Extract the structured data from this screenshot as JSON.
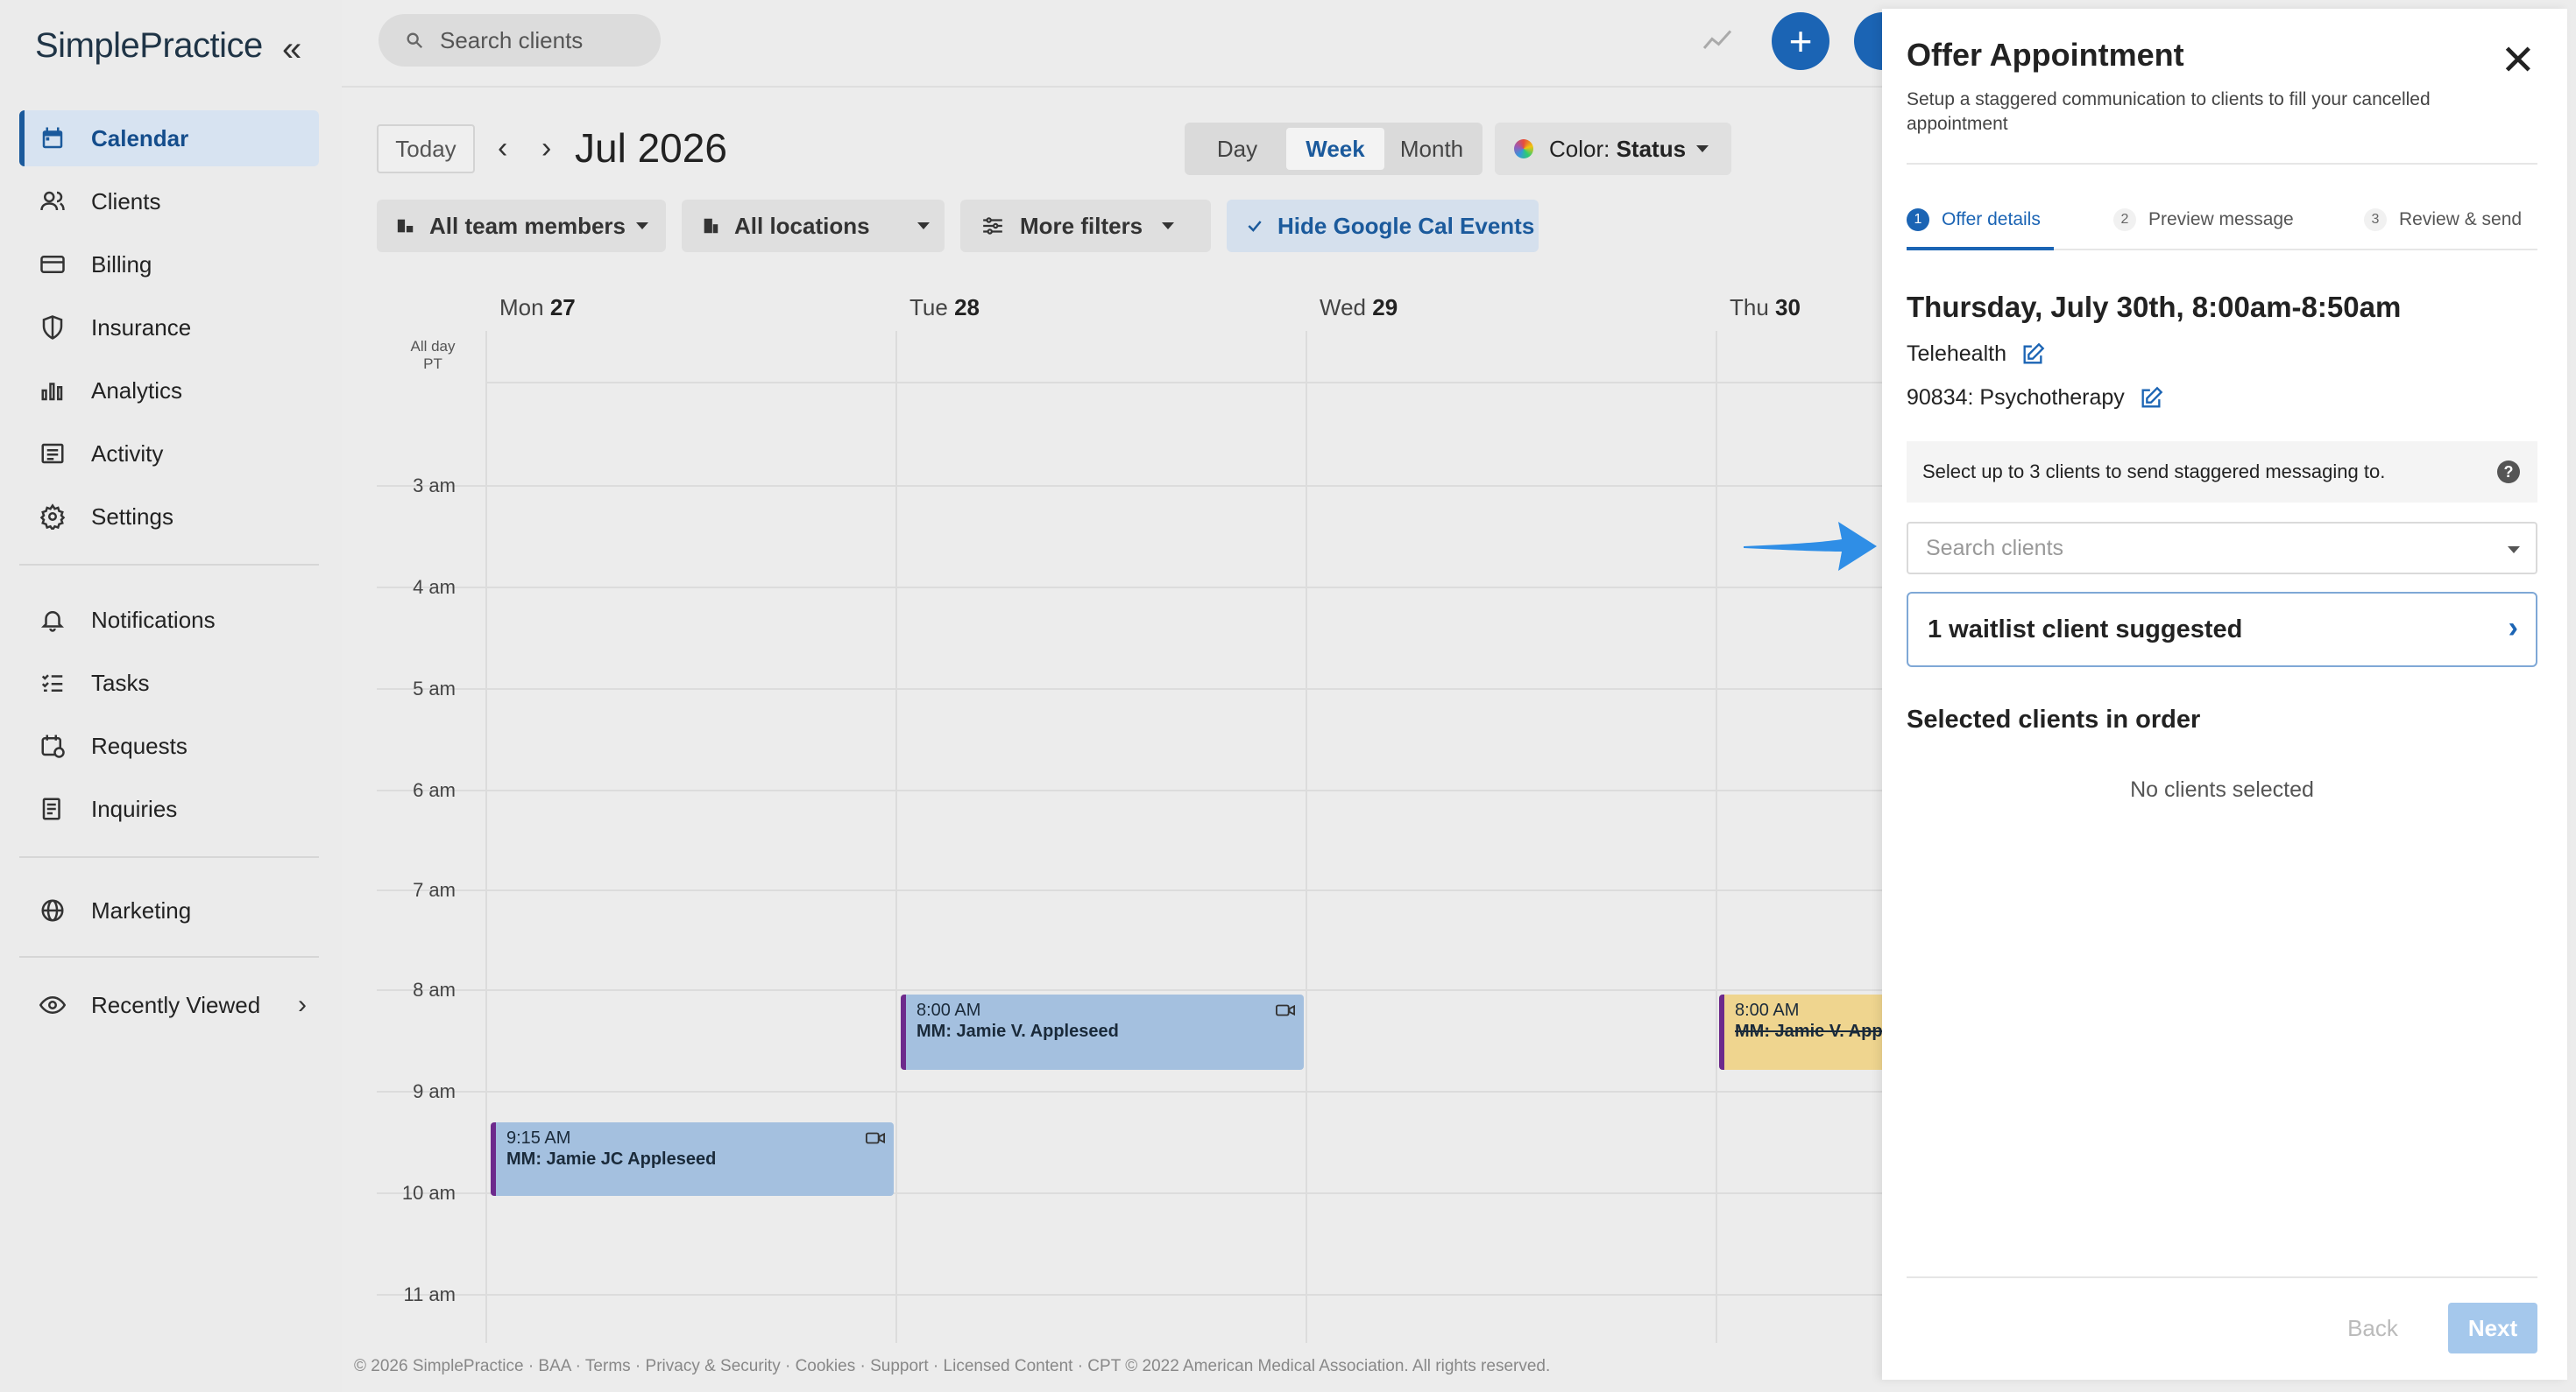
{
  "sidebar": {
    "logo": "SimplePractice",
    "items": [
      {
        "label": "Calendar"
      },
      {
        "label": "Clients"
      },
      {
        "label": "Billing"
      },
      {
        "label": "Insurance"
      },
      {
        "label": "Analytics"
      },
      {
        "label": "Activity"
      },
      {
        "label": "Settings"
      },
      {
        "label": "Notifications"
      },
      {
        "label": "Tasks"
      },
      {
        "label": "Requests"
      },
      {
        "label": "Inquiries"
      },
      {
        "label": "Marketing"
      },
      {
        "label": "Recently Viewed"
      }
    ]
  },
  "topbar": {
    "search_placeholder": "Search clients"
  },
  "toolbar": {
    "today": "Today",
    "month": "Jul 2026",
    "views": [
      "Day",
      "Week",
      "Month"
    ],
    "selected_view": "Week",
    "color_prefix": "Color: ",
    "color_value": "Status",
    "filters": {
      "team": "All team members",
      "locations": "All locations",
      "more": "More filters",
      "hide_google": "Hide Google Cal Events"
    }
  },
  "calendar": {
    "days": [
      {
        "dow": "Mon",
        "num": "27"
      },
      {
        "dow": "Tue",
        "num": "28"
      },
      {
        "dow": "Wed",
        "num": "29"
      },
      {
        "dow": "Thu",
        "num": "30"
      }
    ],
    "allday_label": "All day",
    "tz_label": "PT",
    "hours": [
      "3 am",
      "4 am",
      "5 am",
      "6 am",
      "7 am",
      "8 am",
      "9 am",
      "10 am",
      "11 am"
    ],
    "events": [
      {
        "time": "8:00 AM",
        "name": "MM: Jamie V. Appleseed"
      },
      {
        "time": "9:15 AM",
        "name": "MM: Jamie JC Appleseed"
      },
      {
        "time": "8:00 AM",
        "name": "MM: Jamie V. App"
      }
    ]
  },
  "footer": "© 2026 SimplePractice · BAA · Terms · Privacy & Security · Cookies · Support · Licensed Content · CPT © 2022 American Medical Association. All rights reserved.",
  "panel": {
    "title": "Offer Appointment",
    "subtitle": "Setup a staggered communication to clients to fill your cancelled appointment",
    "steps": [
      {
        "num": "1",
        "label": "Offer details"
      },
      {
        "num": "2",
        "label": "Preview message"
      },
      {
        "num": "3",
        "label": "Review & send"
      }
    ],
    "datetime": "Thursday, July 30th, 8:00am-8:50am",
    "location": "Telehealth",
    "service": "90834: Psychotherapy",
    "info": "Select up to 3 clients to send staggered messaging to.",
    "search_placeholder": "Search clients",
    "waitlist": "1 waitlist client suggested",
    "selected_title": "Selected clients in order",
    "no_selection": "No clients selected",
    "back": "Back",
    "next": "Next"
  },
  "colors": {
    "accent": "#1b64b4",
    "event_blue": "#a4c0df",
    "event_yellow": "#efd58f",
    "event_border": "#6d2a8c"
  }
}
